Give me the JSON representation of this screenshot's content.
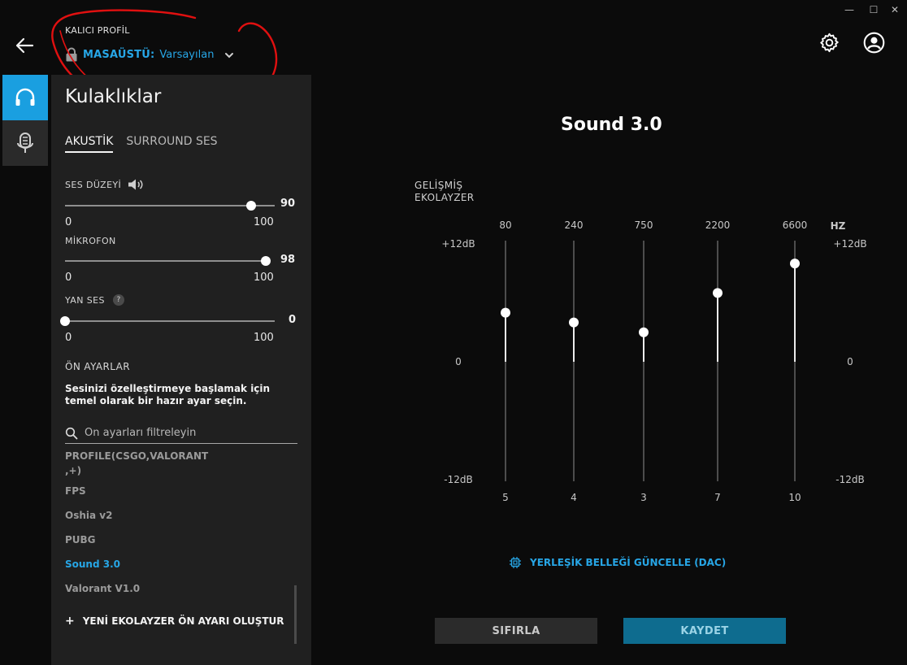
{
  "window": {
    "minimize": "—",
    "maximize": "☐",
    "close": "✕"
  },
  "profile": {
    "kicker": "KALICI PROFİL",
    "name": "MASAÜSTÜ:",
    "value": "Varsayılan"
  },
  "panel": {
    "title": "Kulaklıklar",
    "tabs": [
      "AKUSTİK",
      "SURROUND SES"
    ],
    "volume": {
      "label": "SES DÜZEYİ",
      "value": "90",
      "min": "0",
      "max": "100",
      "fraction": 0.9
    },
    "mic": {
      "label": "MİKROFON",
      "value": "98",
      "min": "0",
      "max": "100",
      "fraction": 0.98
    },
    "sidetone": {
      "label": "YAN SES",
      "help": "?",
      "value": "0",
      "min": "0",
      "max": "100",
      "fraction": 0
    },
    "presets_heading": "ÖN AYARLAR",
    "presets_desc": "Sesinizi özelleştirmeye başlamak için temel olarak bir hazır ayar seçin.",
    "search_placeholder": "Ön ayarları filtreleyin",
    "presets": [
      "PROFİLE(CSGO,VALORANT",
      ",+)",
      "FPS",
      "Oshia v2",
      "PUBG",
      "Sound 3.0",
      "Valorant V1.0"
    ],
    "active_preset": "Sound 3.0",
    "new_preset": "YENİ EKOLAYZER ÖN AYARI OLUŞTUR",
    "new_preset_plus": "+"
  },
  "eq": {
    "title": "Sound 3.0",
    "caption_line1": "GELİŞMİŞ",
    "caption_line2": "EKOLAYZER",
    "hz_label": "HZ",
    "bands": [
      {
        "freq": "80",
        "gain": "5",
        "value": 5
      },
      {
        "freq": "240",
        "gain": "4",
        "value": 4
      },
      {
        "freq": "750",
        "gain": "3",
        "value": 3
      },
      {
        "freq": "2200",
        "gain": "7",
        "value": 7
      },
      {
        "freq": "6600",
        "gain": "10",
        "value": 10
      }
    ],
    "range": [
      -12,
      12
    ],
    "left_axis": {
      "top": "+12dB",
      "mid": "0",
      "bottom": "-12dB"
    },
    "right_axis": {
      "top": "+12dB",
      "mid": "0",
      "bottom": "-12dB"
    }
  },
  "dac_label": "YERLEŞİK BELLEĞİ GÜNCELLE (DAC)",
  "buttons": {
    "reset": "SIFIRLA",
    "save": "KAYDET"
  },
  "colors": {
    "accent": "#27a6e6",
    "save_bg": "#0e6c8f",
    "annotation": "#e01010"
  }
}
